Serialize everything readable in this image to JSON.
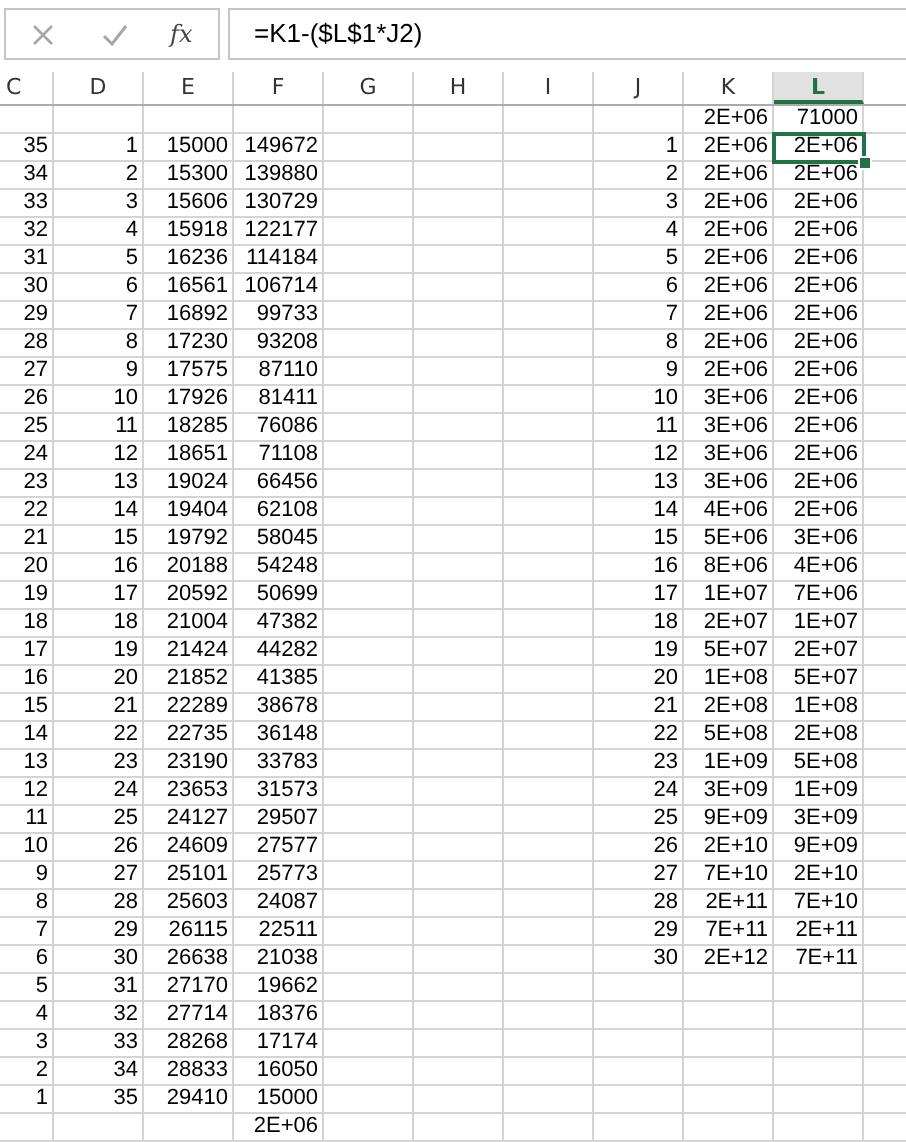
{
  "formula_bar": {
    "function_label": "fx",
    "formula": "=K1-($L$1*J2)"
  },
  "columns": [
    {
      "label": "C",
      "selected": false
    },
    {
      "label": "D",
      "selected": false
    },
    {
      "label": "E",
      "selected": false
    },
    {
      "label": "F",
      "selected": false
    },
    {
      "label": "G",
      "selected": false
    },
    {
      "label": "H",
      "selected": false
    },
    {
      "label": "I",
      "selected": false
    },
    {
      "label": "J",
      "selected": false
    },
    {
      "label": "K",
      "selected": false
    },
    {
      "label": "L",
      "selected": true
    }
  ],
  "rows": [
    {
      "selected": false,
      "cells": [
        null,
        null,
        null,
        null,
        null,
        null,
        null,
        null,
        "2E+06",
        "71000"
      ]
    },
    {
      "selected": true,
      "cells": [
        "35",
        "1",
        "15000",
        "149672",
        null,
        null,
        null,
        "1",
        "2E+06",
        "2E+06"
      ]
    },
    {
      "selected": false,
      "cells": [
        "34",
        "2",
        "15300",
        "139880",
        null,
        null,
        null,
        "2",
        "2E+06",
        "2E+06"
      ]
    },
    {
      "selected": false,
      "cells": [
        "33",
        "3",
        "15606",
        "130729",
        null,
        null,
        null,
        "3",
        "2E+06",
        "2E+06"
      ]
    },
    {
      "selected": false,
      "cells": [
        "32",
        "4",
        "15918",
        "122177",
        null,
        null,
        null,
        "4",
        "2E+06",
        "2E+06"
      ]
    },
    {
      "selected": false,
      "cells": [
        "31",
        "5",
        "16236",
        "114184",
        null,
        null,
        null,
        "5",
        "2E+06",
        "2E+06"
      ]
    },
    {
      "selected": false,
      "cells": [
        "30",
        "6",
        "16561",
        "106714",
        null,
        null,
        null,
        "6",
        "2E+06",
        "2E+06"
      ]
    },
    {
      "selected": false,
      "cells": [
        "29",
        "7",
        "16892",
        "99733",
        null,
        null,
        null,
        "7",
        "2E+06",
        "2E+06"
      ]
    },
    {
      "selected": false,
      "cells": [
        "28",
        "8",
        "17230",
        "93208",
        null,
        null,
        null,
        "8",
        "2E+06",
        "2E+06"
      ]
    },
    {
      "selected": false,
      "cells": [
        "27",
        "9",
        "17575",
        "87110",
        null,
        null,
        null,
        "9",
        "2E+06",
        "2E+06"
      ]
    },
    {
      "selected": false,
      "cells": [
        "26",
        "10",
        "17926",
        "81411",
        null,
        null,
        null,
        "10",
        "3E+06",
        "2E+06"
      ]
    },
    {
      "selected": false,
      "cells": [
        "25",
        "11",
        "18285",
        "76086",
        null,
        null,
        null,
        "11",
        "3E+06",
        "2E+06"
      ]
    },
    {
      "selected": false,
      "cells": [
        "24",
        "12",
        "18651",
        "71108",
        null,
        null,
        null,
        "12",
        "3E+06",
        "2E+06"
      ]
    },
    {
      "selected": false,
      "cells": [
        "23",
        "13",
        "19024",
        "66456",
        null,
        null,
        null,
        "13",
        "3E+06",
        "2E+06"
      ]
    },
    {
      "selected": false,
      "cells": [
        "22",
        "14",
        "19404",
        "62108",
        null,
        null,
        null,
        "14",
        "4E+06",
        "2E+06"
      ]
    },
    {
      "selected": false,
      "cells": [
        "21",
        "15",
        "19792",
        "58045",
        null,
        null,
        null,
        "15",
        "5E+06",
        "3E+06"
      ]
    },
    {
      "selected": false,
      "cells": [
        "20",
        "16",
        "20188",
        "54248",
        null,
        null,
        null,
        "16",
        "8E+06",
        "4E+06"
      ]
    },
    {
      "selected": false,
      "cells": [
        "19",
        "17",
        "20592",
        "50699",
        null,
        null,
        null,
        "17",
        "1E+07",
        "7E+06"
      ]
    },
    {
      "selected": false,
      "cells": [
        "18",
        "18",
        "21004",
        "47382",
        null,
        null,
        null,
        "18",
        "2E+07",
        "1E+07"
      ]
    },
    {
      "selected": false,
      "cells": [
        "17",
        "19",
        "21424",
        "44282",
        null,
        null,
        null,
        "19",
        "5E+07",
        "2E+07"
      ]
    },
    {
      "selected": false,
      "cells": [
        "16",
        "20",
        "21852",
        "41385",
        null,
        null,
        null,
        "20",
        "1E+08",
        "5E+07"
      ]
    },
    {
      "selected": false,
      "cells": [
        "15",
        "21",
        "22289",
        "38678",
        null,
        null,
        null,
        "21",
        "2E+08",
        "1E+08"
      ]
    },
    {
      "selected": false,
      "cells": [
        "14",
        "22",
        "22735",
        "36148",
        null,
        null,
        null,
        "22",
        "5E+08",
        "2E+08"
      ]
    },
    {
      "selected": false,
      "cells": [
        "13",
        "23",
        "23190",
        "33783",
        null,
        null,
        null,
        "23",
        "1E+09",
        "5E+08"
      ]
    },
    {
      "selected": false,
      "cells": [
        "12",
        "24",
        "23653",
        "31573",
        null,
        null,
        null,
        "24",
        "3E+09",
        "1E+09"
      ]
    },
    {
      "selected": false,
      "cells": [
        "11",
        "25",
        "24127",
        "29507",
        null,
        null,
        null,
        "25",
        "9E+09",
        "3E+09"
      ]
    },
    {
      "selected": false,
      "cells": [
        "10",
        "26",
        "24609",
        "27577",
        null,
        null,
        null,
        "26",
        "2E+10",
        "9E+09"
      ]
    },
    {
      "selected": false,
      "cells": [
        "9",
        "27",
        "25101",
        "25773",
        null,
        null,
        null,
        "27",
        "7E+10",
        "2E+10"
      ]
    },
    {
      "selected": false,
      "cells": [
        "8",
        "28",
        "25603",
        "24087",
        null,
        null,
        null,
        "28",
        "2E+11",
        "7E+10"
      ]
    },
    {
      "selected": false,
      "cells": [
        "7",
        "29",
        "26115",
        "22511",
        null,
        null,
        null,
        "29",
        "7E+11",
        "2E+11"
      ]
    },
    {
      "selected": false,
      "cells": [
        "6",
        "30",
        "26638",
        "21038",
        null,
        null,
        null,
        "30",
        "2E+12",
        "7E+11"
      ]
    },
    {
      "selected": false,
      "cells": [
        "5",
        "31",
        "27170",
        "19662",
        null,
        null,
        null,
        null,
        null,
        null
      ]
    },
    {
      "selected": false,
      "cells": [
        "4",
        "32",
        "27714",
        "18376",
        null,
        null,
        null,
        null,
        null,
        null
      ]
    },
    {
      "selected": false,
      "cells": [
        "3",
        "33",
        "28268",
        "17174",
        null,
        null,
        null,
        null,
        null,
        null
      ]
    },
    {
      "selected": false,
      "cells": [
        "2",
        "34",
        "28833",
        "16050",
        null,
        null,
        null,
        null,
        null,
        null
      ]
    },
    {
      "selected": false,
      "cells": [
        "1",
        "35",
        "29410",
        "15000",
        null,
        null,
        null,
        null,
        null,
        null
      ]
    },
    {
      "selected": false,
      "cells": [
        null,
        null,
        null,
        "2E+06",
        null,
        null,
        null,
        null,
        null,
        null
      ]
    }
  ]
}
